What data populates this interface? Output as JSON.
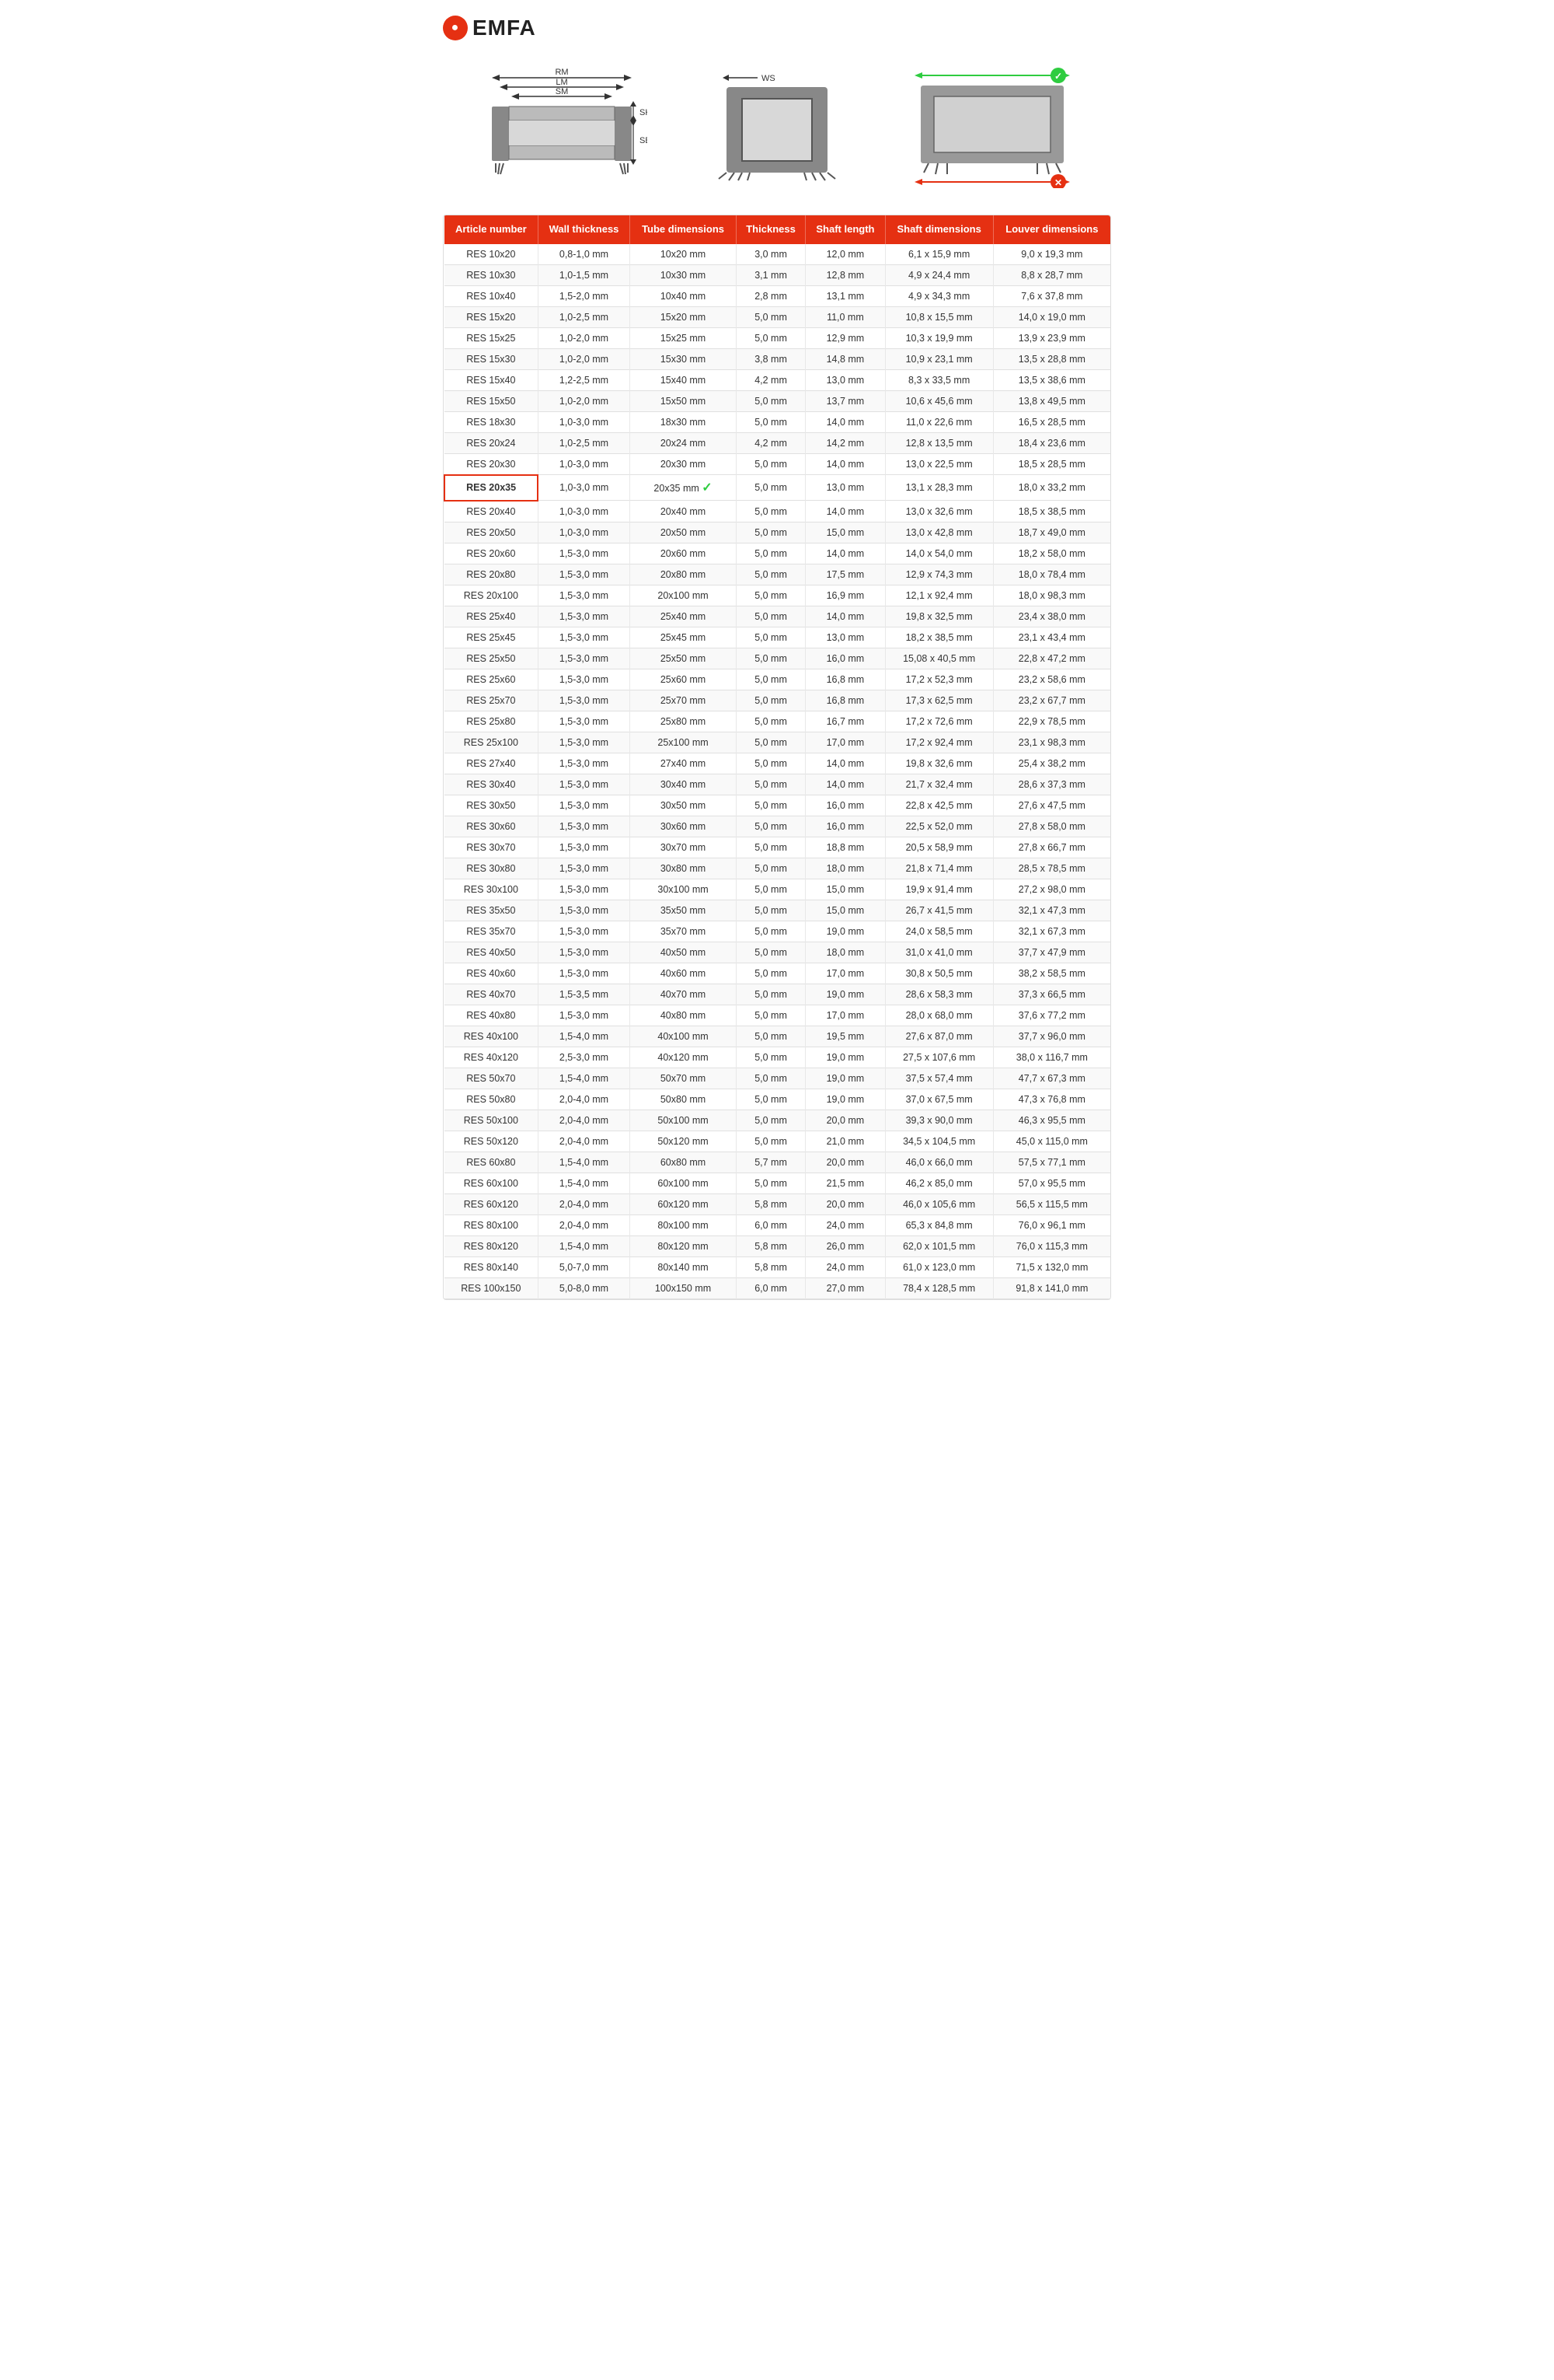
{
  "brand": {
    "name": "EMFA",
    "logo_symbol": "●"
  },
  "diagrams": {
    "labels": {
      "rm": "RM",
      "lm": "LM",
      "sm": "SM",
      "sk": "SK",
      "se": "SE",
      "ws": "WS"
    }
  },
  "table": {
    "headers": [
      "Article number",
      "Wall thickness",
      "Tube dimensions",
      "Thickness",
      "Shaft length",
      "Shaft dimensions",
      "Louver dimensions"
    ],
    "rows": [
      [
        "RES 10x20",
        "0,8-1,0 mm",
        "10x20 mm",
        "3,0 mm",
        "12,0 mm",
        "6,1 x 15,9 mm",
        "9,0 x 19,3 mm"
      ],
      [
        "RES 10x30",
        "1,0-1,5 mm",
        "10x30 mm",
        "3,1 mm",
        "12,8 mm",
        "4,9 x 24,4 mm",
        "8,8 x 28,7 mm"
      ],
      [
        "RES 10x40",
        "1,5-2,0 mm",
        "10x40 mm",
        "2,8 mm",
        "13,1 mm",
        "4,9 x 34,3 mm",
        "7,6 x 37,8 mm"
      ],
      [
        "RES 15x20",
        "1,0-2,5 mm",
        "15x20 mm",
        "5,0 mm",
        "11,0 mm",
        "10,8 x 15,5 mm",
        "14,0 x 19,0 mm"
      ],
      [
        "RES 15x25",
        "1,0-2,0 mm",
        "15x25 mm",
        "5,0 mm",
        "12,9 mm",
        "10,3 x 19,9 mm",
        "13,9 x 23,9 mm"
      ],
      [
        "RES 15x30",
        "1,0-2,0 mm",
        "15x30 mm",
        "3,8 mm",
        "14,8 mm",
        "10,9 x 23,1 mm",
        "13,5 x 28,8 mm"
      ],
      [
        "RES 15x40",
        "1,2-2,5 mm",
        "15x40 mm",
        "4,2 mm",
        "13,0 mm",
        "8,3 x 33,5 mm",
        "13,5 x 38,6 mm"
      ],
      [
        "RES 15x50",
        "1,0-2,0 mm",
        "15x50 mm",
        "5,0 mm",
        "13,7 mm",
        "10,6 x 45,6 mm",
        "13,8 x 49,5 mm"
      ],
      [
        "RES 18x30",
        "1,0-3,0 mm",
        "18x30 mm",
        "5,0 mm",
        "14,0 mm",
        "11,0 x 22,6 mm",
        "16,5 x 28,5 mm"
      ],
      [
        "RES 20x24",
        "1,0-2,5 mm",
        "20x24 mm",
        "4,2 mm",
        "14,2 mm",
        "12,8 x 13,5 mm",
        "18,4 x 23,6 mm"
      ],
      [
        "RES 20x30",
        "1,0-3,0 mm",
        "20x30 mm",
        "5,0 mm",
        "14,0 mm",
        "13,0 x 22,5 mm",
        "18,5 x 28,5 mm"
      ],
      [
        "RES 20x35",
        "1,0-3,0 mm",
        "20x35 mm",
        "5,0 mm",
        "13,0 mm",
        "13,1 x 28,3 mm",
        "18,0 x 33,2 mm"
      ],
      [
        "RES 20x40",
        "1,0-3,0 mm",
        "20x40 mm",
        "5,0 mm",
        "14,0 mm",
        "13,0 x 32,6 mm",
        "18,5 x 38,5 mm"
      ],
      [
        "RES 20x50",
        "1,0-3,0 mm",
        "20x50 mm",
        "5,0 mm",
        "15,0 mm",
        "13,0 x 42,8 mm",
        "18,7 x 49,0 mm"
      ],
      [
        "RES 20x60",
        "1,5-3,0 mm",
        "20x60 mm",
        "5,0 mm",
        "14,0 mm",
        "14,0 x 54,0 mm",
        "18,2 x 58,0 mm"
      ],
      [
        "RES 20x80",
        "1,5-3,0 mm",
        "20x80 mm",
        "5,0 mm",
        "17,5 mm",
        "12,9 x 74,3 mm",
        "18,0 x 78,4 mm"
      ],
      [
        "RES 20x100",
        "1,5-3,0 mm",
        "20x100 mm",
        "5,0 mm",
        "16,9 mm",
        "12,1 x 92,4 mm",
        "18,0 x 98,3 mm"
      ],
      [
        "RES 25x40",
        "1,5-3,0 mm",
        "25x40 mm",
        "5,0 mm",
        "14,0 mm",
        "19,8 x 32,5 mm",
        "23,4 x 38,0 mm"
      ],
      [
        "RES 25x45",
        "1,5-3,0 mm",
        "25x45 mm",
        "5,0 mm",
        "13,0 mm",
        "18,2 x 38,5 mm",
        "23,1 x 43,4 mm"
      ],
      [
        "RES 25x50",
        "1,5-3,0 mm",
        "25x50 mm",
        "5,0 mm",
        "16,0 mm",
        "15,08 x 40,5 mm",
        "22,8 x 47,2 mm"
      ],
      [
        "RES 25x60",
        "1,5-3,0 mm",
        "25x60 mm",
        "5,0 mm",
        "16,8 mm",
        "17,2 x 52,3 mm",
        "23,2 x 58,6 mm"
      ],
      [
        "RES 25x70",
        "1,5-3,0 mm",
        "25x70 mm",
        "5,0 mm",
        "16,8 mm",
        "17,3 x 62,5 mm",
        "23,2 x 67,7 mm"
      ],
      [
        "RES 25x80",
        "1,5-3,0 mm",
        "25x80 mm",
        "5,0 mm",
        "16,7 mm",
        "17,2 x 72,6 mm",
        "22,9 x 78,5 mm"
      ],
      [
        "RES 25x100",
        "1,5-3,0 mm",
        "25x100 mm",
        "5,0 mm",
        "17,0 mm",
        "17,2 x 92,4 mm",
        "23,1 x 98,3 mm"
      ],
      [
        "RES 27x40",
        "1,5-3,0 mm",
        "27x40 mm",
        "5,0 mm",
        "14,0 mm",
        "19,8 x 32,6 mm",
        "25,4 x 38,2 mm"
      ],
      [
        "RES 30x40",
        "1,5-3,0 mm",
        "30x40 mm",
        "5,0 mm",
        "14,0 mm",
        "21,7 x 32,4 mm",
        "28,6 x 37,3 mm"
      ],
      [
        "RES 30x50",
        "1,5-3,0 mm",
        "30x50 mm",
        "5,0 mm",
        "16,0 mm",
        "22,8 x 42,5 mm",
        "27,6 x 47,5 mm"
      ],
      [
        "RES 30x60",
        "1,5-3,0 mm",
        "30x60 mm",
        "5,0 mm",
        "16,0 mm",
        "22,5 x 52,0 mm",
        "27,8 x 58,0 mm"
      ],
      [
        "RES 30x70",
        "1,5-3,0 mm",
        "30x70 mm",
        "5,0 mm",
        "18,8 mm",
        "20,5 x 58,9 mm",
        "27,8 x 66,7 mm"
      ],
      [
        "RES 30x80",
        "1,5-3,0 mm",
        "30x80 mm",
        "5,0 mm",
        "18,0 mm",
        "21,8 x 71,4 mm",
        "28,5 x 78,5 mm"
      ],
      [
        "RES 30x100",
        "1,5-3,0 mm",
        "30x100 mm",
        "5,0 mm",
        "15,0 mm",
        "19,9 x 91,4 mm",
        "27,2 x 98,0 mm"
      ],
      [
        "RES 35x50",
        "1,5-3,0 mm",
        "35x50 mm",
        "5,0 mm",
        "15,0 mm",
        "26,7 x 41,5 mm",
        "32,1 x 47,3 mm"
      ],
      [
        "RES 35x70",
        "1,5-3,0 mm",
        "35x70 mm",
        "5,0 mm",
        "19,0 mm",
        "24,0 x 58,5 mm",
        "32,1 x 67,3 mm"
      ],
      [
        "RES 40x50",
        "1,5-3,0 mm",
        "40x50 mm",
        "5,0 mm",
        "18,0 mm",
        "31,0 x 41,0 mm",
        "37,7 x 47,9 mm"
      ],
      [
        "RES 40x60",
        "1,5-3,0 mm",
        "40x60 mm",
        "5,0 mm",
        "17,0 mm",
        "30,8 x 50,5 mm",
        "38,2 x 58,5 mm"
      ],
      [
        "RES 40x70",
        "1,5-3,5 mm",
        "40x70 mm",
        "5,0 mm",
        "19,0 mm",
        "28,6 x 58,3 mm",
        "37,3 x 66,5 mm"
      ],
      [
        "RES 40x80",
        "1,5-3,0 mm",
        "40x80 mm",
        "5,0 mm",
        "17,0 mm",
        "28,0 x 68,0 mm",
        "37,6 x 77,2 mm"
      ],
      [
        "RES 40x100",
        "1,5-4,0 mm",
        "40x100 mm",
        "5,0 mm",
        "19,5 mm",
        "27,6 x 87,0 mm",
        "37,7 x 96,0 mm"
      ],
      [
        "RES 40x120",
        "2,5-3,0 mm",
        "40x120 mm",
        "5,0 mm",
        "19,0 mm",
        "27,5 x 107,6 mm",
        "38,0 x 116,7 mm"
      ],
      [
        "RES 50x70",
        "1,5-4,0 mm",
        "50x70 mm",
        "5,0 mm",
        "19,0 mm",
        "37,5 x 57,4 mm",
        "47,7 x 67,3 mm"
      ],
      [
        "RES 50x80",
        "2,0-4,0 mm",
        "50x80 mm",
        "5,0 mm",
        "19,0 mm",
        "37,0 x 67,5 mm",
        "47,3 x 76,8 mm"
      ],
      [
        "RES 50x100",
        "2,0-4,0 mm",
        "50x100 mm",
        "5,0 mm",
        "20,0 mm",
        "39,3 x 90,0 mm",
        "46,3 x 95,5 mm"
      ],
      [
        "RES 50x120",
        "2,0-4,0 mm",
        "50x120 mm",
        "5,0 mm",
        "21,0 mm",
        "34,5 x 104,5 mm",
        "45,0 x 115,0 mm"
      ],
      [
        "RES 60x80",
        "1,5-4,0 mm",
        "60x80 mm",
        "5,7 mm",
        "20,0 mm",
        "46,0 x 66,0 mm",
        "57,5 x 77,1 mm"
      ],
      [
        "RES 60x100",
        "1,5-4,0 mm",
        "60x100 mm",
        "5,0 mm",
        "21,5 mm",
        "46,2 x 85,0 mm",
        "57,0 x 95,5 mm"
      ],
      [
        "RES 60x120",
        "2,0-4,0 mm",
        "60x120 mm",
        "5,8 mm",
        "20,0 mm",
        "46,0 x 105,6 mm",
        "56,5 x 115,5 mm"
      ],
      [
        "RES 80x100",
        "2,0-4,0 mm",
        "80x100 mm",
        "6,0 mm",
        "24,0 mm",
        "65,3 x 84,8 mm",
        "76,0 x 96,1 mm"
      ],
      [
        "RES 80x120",
        "1,5-4,0 mm",
        "80x120 mm",
        "5,8 mm",
        "26,0 mm",
        "62,0 x 101,5 mm",
        "76,0 x 115,3 mm"
      ],
      [
        "RES 80x140",
        "5,0-7,0 mm",
        "80x140 mm",
        "5,8 mm",
        "24,0 mm",
        "61,0 x 123,0 mm",
        "71,5 x 132,0 mm"
      ],
      [
        "RES 100x150",
        "5,0-8,0 mm",
        "100x150 mm",
        "6,0 mm",
        "27,0 mm",
        "78,4 x 128,5 mm",
        "91,8 x 141,0 mm"
      ]
    ],
    "highlighted_row_index": 11
  }
}
